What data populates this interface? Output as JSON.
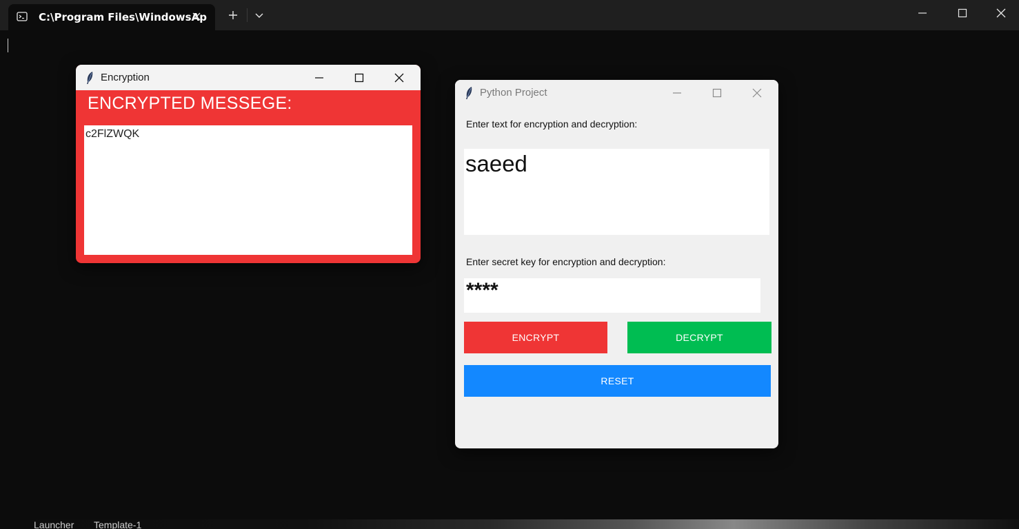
{
  "terminal": {
    "tab_title": "C:\\Program Files\\WindowsAp"
  },
  "taskbar": {
    "items": [
      "Launcher",
      "Template-1"
    ]
  },
  "encryption_window": {
    "title": "Encryption",
    "heading": "ENCRYPTED MESSEGE:",
    "message": "c2FlZWQK",
    "background": "#ef3535"
  },
  "project_window": {
    "title": "Python Project",
    "text_label": "Enter text for encryption and decryption:",
    "text_value": "saeed",
    "key_label": "Enter secret key for encryption and decryption:",
    "key_value": "****",
    "encrypt_label": "ENCRYPT",
    "decrypt_label": "DECRYPT",
    "reset_label": "RESET",
    "colors": {
      "encrypt": "#ef3535",
      "decrypt": "#00bd52",
      "reset": "#1388ff"
    }
  }
}
